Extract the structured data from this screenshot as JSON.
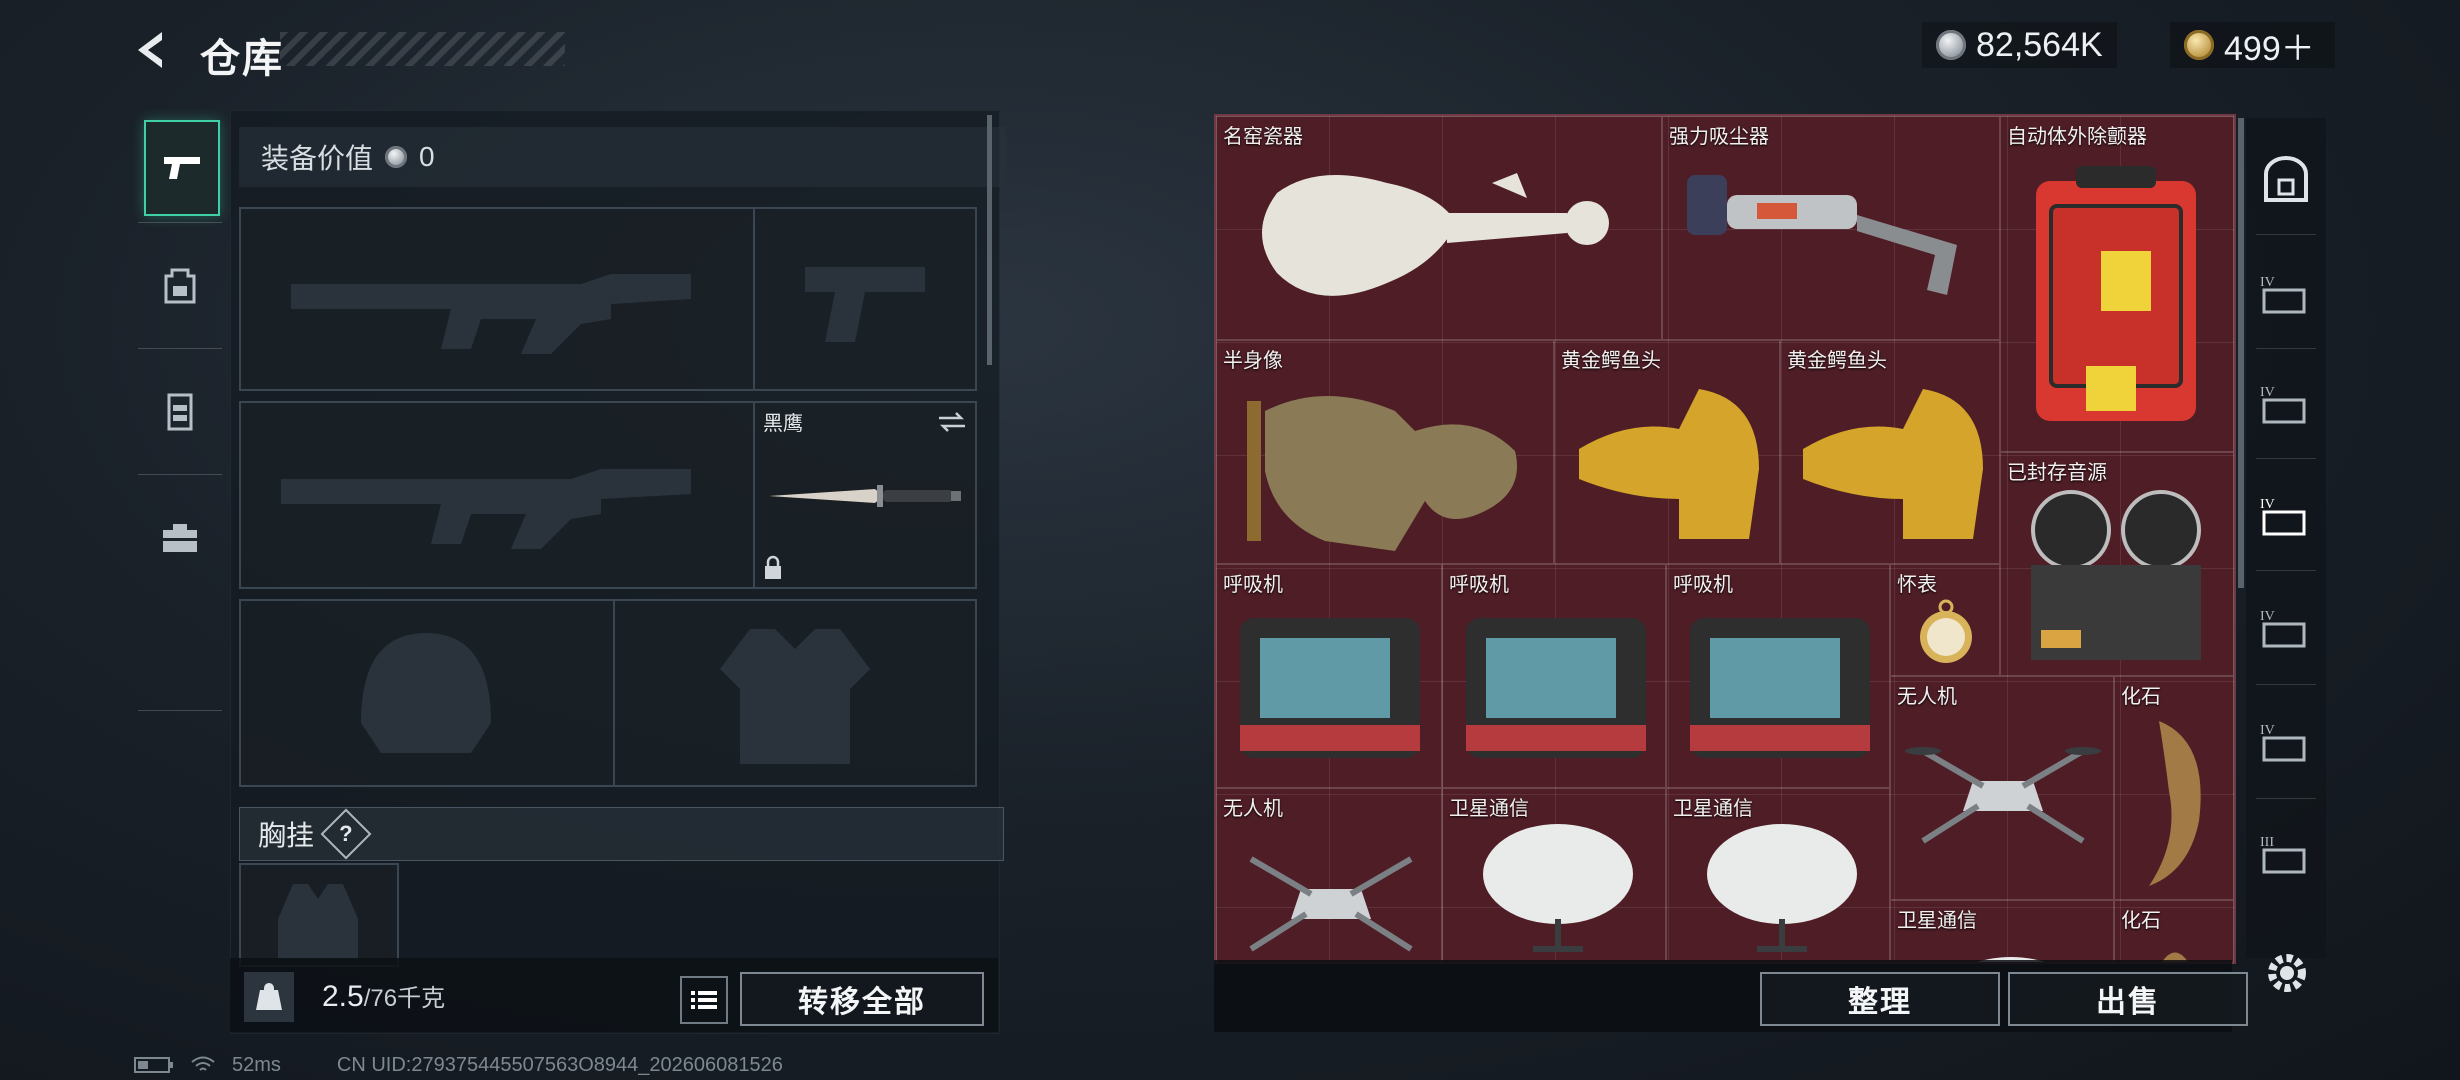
{
  "header": {
    "title": "仓库",
    "currencies": [
      {
        "icon": "silver-coin-icon",
        "value": "82,564K"
      },
      {
        "icon": "gold-coin-icon",
        "value": "499＋"
      }
    ]
  },
  "categories": [
    {
      "icon": "pistol-icon",
      "active": true
    },
    {
      "icon": "backpack-icon",
      "active": false
    },
    {
      "icon": "vest-icon",
      "active": false
    },
    {
      "icon": "toolbox-icon",
      "active": false
    }
  ],
  "loadout": {
    "value_label": "装备价值",
    "value": "0",
    "melee_slot_label": "黑鹰",
    "chest_rig_label": "胸挂",
    "chest_rig_help": "?",
    "weight": "2.5",
    "weight_max": "/76千克",
    "transfer_all": "转移全部"
  },
  "stash": {
    "items": [
      {
        "id": "vase",
        "name": "名窑瓷器"
      },
      {
        "id": "vacuum",
        "name": "强力吸尘器"
      },
      {
        "id": "aed",
        "name": "自动体外除颤器"
      },
      {
        "id": "bust",
        "name": "半身像"
      },
      {
        "id": "croc1",
        "name": "黄金鳄鱼头"
      },
      {
        "id": "croc2",
        "name": "黄金鳄鱼头"
      },
      {
        "id": "reel",
        "name": "已封存音源"
      },
      {
        "id": "vent1",
        "name": "呼吸机"
      },
      {
        "id": "vent2",
        "name": "呼吸机"
      },
      {
        "id": "vent3",
        "name": "呼吸机"
      },
      {
        "id": "watch",
        "name": "怀表"
      },
      {
        "id": "drone1",
        "name": "无人机"
      },
      {
        "id": "fossil1",
        "name": "化石"
      },
      {
        "id": "drone2",
        "name": "无人机"
      },
      {
        "id": "sat1",
        "name": "卫星通信"
      },
      {
        "id": "sat2",
        "name": "卫星通信"
      },
      {
        "id": "sat3",
        "name": "卫星通信"
      },
      {
        "id": "fossil2",
        "name": "化石"
      }
    ],
    "organize": "整理",
    "sell": "出售"
  },
  "right_tabs": [
    {
      "icon": "safe-box-icon",
      "label": ""
    },
    {
      "icon": "storage-tier-icon",
      "label": "IV"
    },
    {
      "icon": "storage-tier-icon",
      "label": "IV"
    },
    {
      "icon": "storage-tier-icon",
      "label": "IV"
    },
    {
      "icon": "storage-tier-icon",
      "label": "IV"
    },
    {
      "icon": "storage-tier-icon",
      "label": "IV"
    },
    {
      "icon": "storage-tier-icon",
      "label": "III"
    }
  ],
  "status": {
    "ping": "52ms",
    "uid": "CN UID:279375445507563O8944_202606081526"
  },
  "colors": {
    "accent": "#3fd0a8",
    "grid_bg": "#4f1d26"
  }
}
